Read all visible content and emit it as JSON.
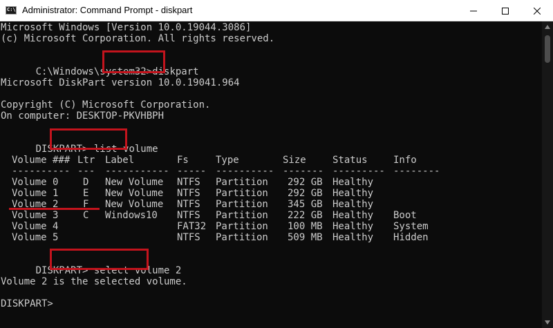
{
  "window": {
    "title": "Administrator: Command Prompt - diskpart",
    "icon_text": "C:\\",
    "controls": {
      "minimize_icon": "minimize-icon",
      "maximize_icon": "maximize-icon",
      "close_icon": "close-icon"
    }
  },
  "console": {
    "lines": [
      "Microsoft Windows [Version 10.0.19044.3086]",
      "(c) Microsoft Corporation. All rights reserved.",
      "C:\\Windows\\system32>",
      "Microsoft DiskPart version 10.0.19041.964",
      "Copyright (C) Microsoft Corporation.",
      "On computer: DESKTOP-PKVHBPH",
      "DISKPART> ",
      "DISKPART> ",
      "Volume 2 is the selected volume.",
      "DISKPART>"
    ],
    "commands": {
      "cmd1": "diskpart",
      "cmd2": "list volume",
      "cmd3": "select volume 2"
    },
    "table": {
      "headers": [
        "Volume ###",
        "Ltr",
        "Label",
        "Fs",
        "Type",
        "Size",
        "Status",
        "Info"
      ],
      "separators": [
        "----------",
        "---",
        "-----------",
        "-----",
        "----------",
        "-------",
        "---------",
        "--------"
      ],
      "rows": [
        [
          "Volume 0",
          "D",
          "New Volume",
          "NTFS",
          "Partition",
          "292 GB",
          "Healthy",
          ""
        ],
        [
          "Volume 1",
          "E",
          "New Volume",
          "NTFS",
          "Partition",
          "292 GB",
          "Healthy",
          ""
        ],
        [
          "Volume 2",
          "F",
          "New Volume",
          "NTFS",
          "Partition",
          "345 GB",
          "Healthy",
          ""
        ],
        [
          "Volume 3",
          "C",
          "Windows10",
          "NTFS",
          "Partition",
          "222 GB",
          "Healthy",
          "Boot"
        ],
        [
          "Volume 4",
          "",
          "",
          "FAT32",
          "Partition",
          "100 MB",
          "Healthy",
          "System"
        ],
        [
          "Volume 5",
          "",
          "",
          "NTFS",
          "Partition",
          "509 MB",
          "Healthy",
          "Hidden"
        ]
      ]
    }
  },
  "colors": {
    "console_bg": "#0c0c0c",
    "console_text": "#cccccc",
    "annotation": "#c3141d"
  }
}
